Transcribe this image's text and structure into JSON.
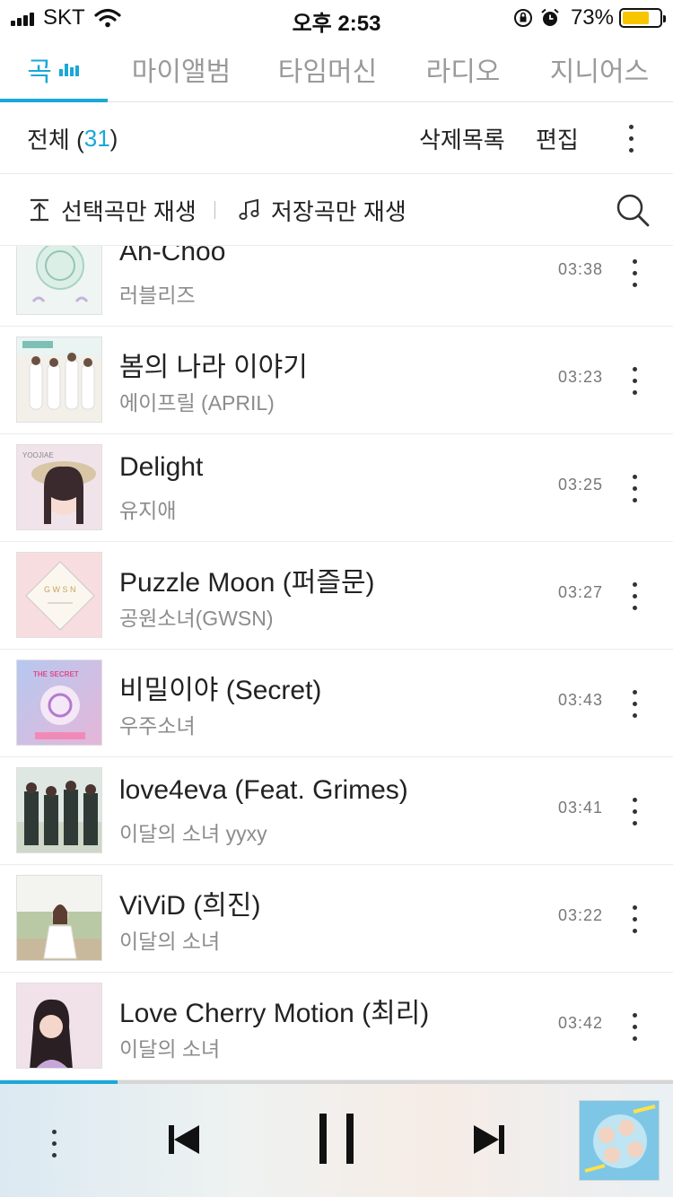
{
  "status_bar": {
    "carrier": "SKT",
    "time": "오후 2:53",
    "battery_percent": "73%",
    "battery_level": 0.73,
    "battery_color": "#f7c600"
  },
  "tabs": [
    {
      "label": "곡",
      "active": true
    },
    {
      "label": "마이앨범",
      "active": false
    },
    {
      "label": "타임머신",
      "active": false
    },
    {
      "label": "라디오",
      "active": false
    },
    {
      "label": "지니어스",
      "active": false
    }
  ],
  "accent_color": "#1aa8d8",
  "header": {
    "total_label": "전체 (",
    "total_count": "31",
    "total_close": ")",
    "delete_list_label": "삭제목록",
    "edit_label": "편집",
    "more_icon": "more-vertical-icon"
  },
  "actions": {
    "play_selected_label": "선택곡만 재생",
    "play_selected_icon": "upload-play-icon",
    "play_saved_label": "저장곡만 재생",
    "play_saved_icon": "music-note-icon",
    "search_icon": "search-icon"
  },
  "songs": [
    {
      "title": "Ah-Choo",
      "artist": "러블리즈",
      "duration": "03:38"
    },
    {
      "title": "봄의 나라 이야기",
      "artist": "에이프릴 (APRIL)",
      "duration": "03:23"
    },
    {
      "title": "Delight",
      "artist": "유지애",
      "duration": "03:25"
    },
    {
      "title": "Puzzle Moon (퍼즐문)",
      "artist": "공원소녀(GWSN)",
      "duration": "03:27"
    },
    {
      "title": "비밀이야 (Secret)",
      "artist": "우주소녀",
      "duration": "03:43"
    },
    {
      "title": "love4eva (Feat. Grimes)",
      "artist": "이달의 소녀 yyxy",
      "duration": "03:41"
    },
    {
      "title": "ViViD (희진)",
      "artist": "이달의 소녀",
      "duration": "03:22"
    },
    {
      "title": "Love Cherry Motion (최리)",
      "artist": "이달의 소녀",
      "duration": "03:42"
    }
  ],
  "player": {
    "progress": 0.175,
    "icons": [
      "more-vertical-icon",
      "previous-track-icon",
      "pause-icon",
      "next-track-icon"
    ]
  }
}
